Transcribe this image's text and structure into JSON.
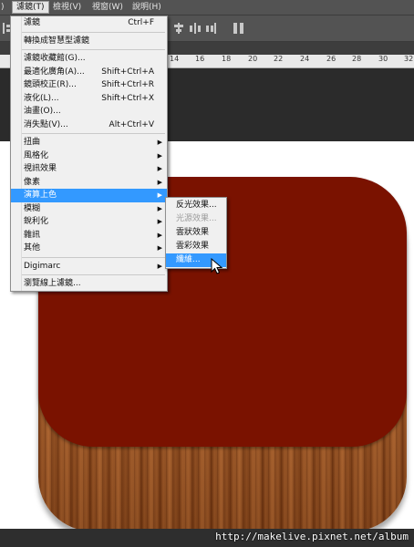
{
  "menubar": {
    "items": [
      {
        "label": ")"
      },
      {
        "label": "濾鏡(T)"
      },
      {
        "label": "檢視(V)"
      },
      {
        "label": "視窗(W)"
      },
      {
        "label": "說明(H)"
      }
    ]
  },
  "ruler": {
    "ticks": [
      "14",
      "16",
      "18",
      "20",
      "22",
      "24",
      "26",
      "28",
      "30",
      "32"
    ]
  },
  "filter_menu": {
    "items": [
      {
        "label": "濾鏡",
        "shortcut": "Ctrl+F"
      },
      {
        "sep": true
      },
      {
        "label": "轉換成智慧型濾鏡"
      },
      {
        "sep": true
      },
      {
        "label": "濾鏡收藏館(G)..."
      },
      {
        "label": "最適化廣角(A)...",
        "shortcut": "Shift+Ctrl+A"
      },
      {
        "label": "鏡頭校正(R)...",
        "shortcut": "Shift+Ctrl+R"
      },
      {
        "label": "液化(L)...",
        "shortcut": "Shift+Ctrl+X"
      },
      {
        "label": "油畫(O)..."
      },
      {
        "label": "消失點(V)...",
        "shortcut": "Alt+Ctrl+V"
      },
      {
        "sep": true
      },
      {
        "label": "扭曲",
        "submenu": true
      },
      {
        "label": "風格化",
        "submenu": true
      },
      {
        "label": "視訊效果",
        "submenu": true
      },
      {
        "label": "像素",
        "submenu": true
      },
      {
        "label": "演算上色",
        "submenu": true,
        "highlight": true
      },
      {
        "label": "模糊",
        "submenu": true
      },
      {
        "label": "銳利化",
        "submenu": true
      },
      {
        "label": "雜訊",
        "submenu": true
      },
      {
        "label": "其他",
        "submenu": true
      },
      {
        "sep": true
      },
      {
        "label": "Digimarc",
        "submenu": true
      },
      {
        "sep": true
      },
      {
        "label": "瀏覽線上濾鏡..."
      }
    ]
  },
  "render_submenu": {
    "items": [
      {
        "label": "反光效果...",
        "disabled": false
      },
      {
        "label": "光源效果...",
        "disabled": true
      },
      {
        "label": "雲狀效果",
        "disabled": false
      },
      {
        "label": "雲彩效果",
        "disabled": false
      },
      {
        "label": "纖維...",
        "selected": true
      }
    ]
  },
  "colors": {
    "menubar": "#535353",
    "highlight": "#3399ff",
    "icon_red": "#7a1200",
    "wood": "#a85f2c"
  },
  "watermark": "http://makelive.pixnet.net/album"
}
